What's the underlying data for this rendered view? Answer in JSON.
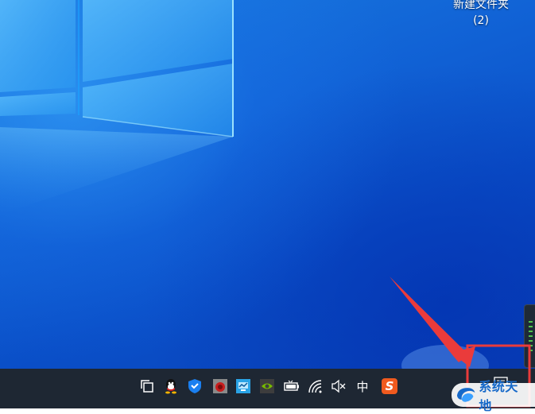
{
  "desktop": {
    "folder": {
      "name_line1": "新建文件夹",
      "name_line2": "(2)"
    }
  },
  "taskbar": {
    "tray_icons": [
      {
        "name": "task-view-icon"
      },
      {
        "name": "qq-penguin-icon"
      },
      {
        "name": "security-shield-icon"
      },
      {
        "name": "red-app-icon"
      },
      {
        "name": "network-monitor-icon"
      },
      {
        "name": "nvidia-icon"
      },
      {
        "name": "battery-icon"
      },
      {
        "name": "wifi-icon"
      },
      {
        "name": "volume-muted-icon"
      },
      {
        "name": "ime-chinese-icon"
      },
      {
        "name": "sogou-input-icon"
      }
    ],
    "ime_label": "中",
    "sogou_letter": "S"
  },
  "watermark": {
    "text": "系统天地"
  },
  "colors": {
    "annotation": "#ea3b3b",
    "taskbar": "#1e2733",
    "desktop": "#1163d6",
    "watermark_text": "#1669c9"
  }
}
